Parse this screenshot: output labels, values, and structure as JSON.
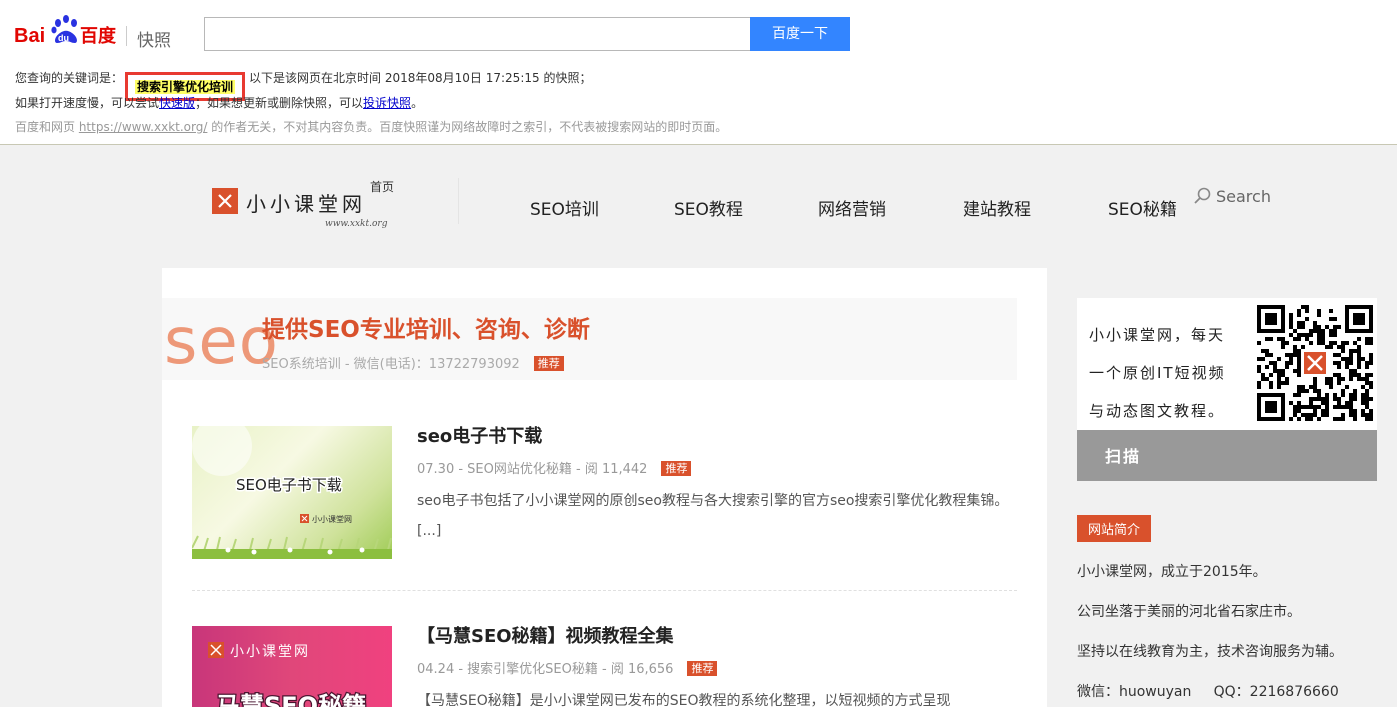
{
  "snapshot": {
    "logo_text_bai": "Bai",
    "logo_text_du": "du",
    "logo_text_cn": "百度",
    "snapshot_label": "快照",
    "search_value": "",
    "search_button": "百度一下",
    "line1_prefix": "您查询的关键词是：",
    "keyword": "搜索引擎优化培训",
    "line1_suffix": "以下是该网页在北京时间 2018年08月10日 17:25:15 的快照；",
    "line2_prefix": "如果打开速度慢，可以尝试",
    "fast_link": "快速版",
    "line2_middle": "；如果想更新或删除快照，可以",
    "complain_link": "投诉快照",
    "line2_suffix": "。",
    "line3_prefix": "百度和网页 ",
    "url": "https://www.xxkt.org/",
    "line3_suffix": " 的作者无关，不对其内容负责。百度快照谨为网络故障时之索引，不代表被搜索网站的即时页面。"
  },
  "site": {
    "logo_name": "小小课堂网",
    "logo_url": "www.xxkt.org",
    "home_label": "首页",
    "nav": [
      "SEO培训",
      "SEO教程",
      "网络营销",
      "建站教程",
      "SEO秘籍"
    ],
    "search_label": "Search"
  },
  "banner": {
    "seo_text": "seo",
    "title": "提供SEO专业培训、咨询、诊断",
    "subtitle": "SEO系统培训 - 微信(电话)：13722793092",
    "tag": "推荐"
  },
  "posts": [
    {
      "title": "seo电子书下载",
      "meta": "07.30 - SEO网站优化秘籍 - 阅 11,442",
      "tag": "推荐",
      "excerpt": "seo电子书包括了小小课堂网的原创seo教程与各大搜索引擎的官方seo搜索引擎优化教程集锦。[...]",
      "thumb_text": "SEO电子书下载",
      "thumb_brand": "小小课堂网"
    },
    {
      "title": "【马慧SEO秘籍】视频教程全集",
      "meta": "04.24 - 搜索引擎优化SEO秘籍 - 阅 16,656",
      "tag": "推荐",
      "excerpt": "【马慧SEO秘籍】是小小课堂网已发布的SEO教程的系统化整理，以短视频的方式呈现",
      "thumb_brand": "小小课堂网",
      "thumb_text": "马慧SEO秘籍"
    }
  ],
  "sidebar": {
    "qr_lines": [
      "小小课堂网，每天",
      "一个原创IT短视频",
      "与动态图文教程。"
    ],
    "scan_label": "扫描",
    "intro_title": "网站简介",
    "intro_lines": [
      "小小课堂网，成立于2015年。",
      "公司坐落于美丽的河北省石家庄市。",
      "坚持以在线教育为主，技术咨询服务为辅。",
      "微信：huowuyan     QQ：2216876660"
    ]
  },
  "colors": {
    "baidu_red": "#e10602",
    "baidu_blue": "#2932e1",
    "search_button": "#3385ff",
    "accent": "#d9512c"
  }
}
